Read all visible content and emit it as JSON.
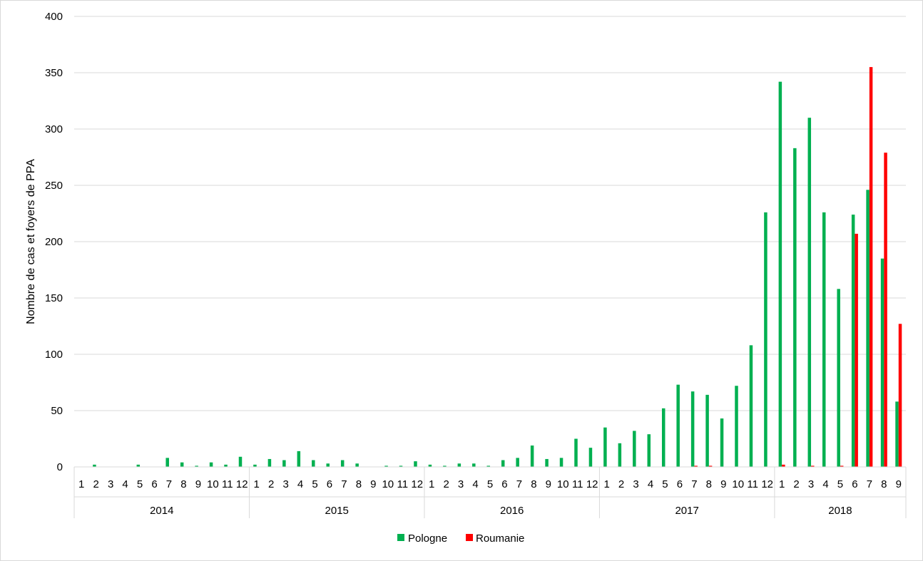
{
  "chart_data": {
    "type": "bar",
    "ylabel": "Nombre de cas et foyers de PPA",
    "ylim": [
      0,
      400
    ],
    "yticks": [
      0,
      50,
      100,
      150,
      200,
      250,
      300,
      350,
      400
    ],
    "grid": true,
    "legend_position": "bottom",
    "groups": [
      {
        "label": "2014",
        "months": [
          "1",
          "2",
          "3",
          "4",
          "5",
          "6",
          "7",
          "8",
          "9",
          "10",
          "11",
          "12"
        ]
      },
      {
        "label": "2015",
        "months": [
          "1",
          "2",
          "3",
          "4",
          "5",
          "6",
          "7",
          "8",
          "9",
          "10",
          "11",
          "12"
        ]
      },
      {
        "label": "2016",
        "months": [
          "1",
          "2",
          "3",
          "4",
          "5",
          "6",
          "7",
          "8",
          "9",
          "10",
          "11",
          "12"
        ]
      },
      {
        "label": "2017",
        "months": [
          "1",
          "2",
          "3",
          "4",
          "5",
          "6",
          "7",
          "8",
          "9",
          "10",
          "11",
          "12"
        ]
      },
      {
        "label": "2018",
        "months": [
          "1",
          "2",
          "3",
          "4",
          "5",
          "6",
          "7",
          "8",
          "9"
        ]
      }
    ],
    "series": [
      {
        "name": "Pologne",
        "color": "#00b050",
        "values": [
          0,
          2,
          0,
          0,
          2,
          0,
          8,
          4,
          1,
          4,
          2,
          9,
          2,
          7,
          6,
          14,
          6,
          3,
          6,
          3,
          0,
          1,
          1,
          5,
          2,
          1,
          3,
          3,
          1,
          6,
          8,
          19,
          7,
          8,
          25,
          17,
          35,
          21,
          32,
          29,
          52,
          73,
          67,
          64,
          43,
          72,
          108,
          226,
          342,
          283,
          310,
          226,
          158,
          224,
          246,
          185,
          58
        ]
      },
      {
        "name": "Roumanie",
        "color": "#ff0000",
        "values": [
          0,
          0,
          0,
          0,
          0,
          0,
          0,
          0,
          0,
          0,
          0,
          0,
          0,
          0,
          0,
          0,
          0,
          0,
          0,
          0,
          0,
          0,
          0,
          0,
          0,
          0,
          0,
          0,
          0,
          0,
          0,
          0,
          0,
          0,
          0,
          0,
          0,
          0,
          0,
          0,
          0,
          0,
          1,
          1,
          0,
          0,
          0,
          0,
          2,
          0,
          1,
          0,
          1,
          207,
          355,
          279,
          127
        ]
      }
    ]
  }
}
